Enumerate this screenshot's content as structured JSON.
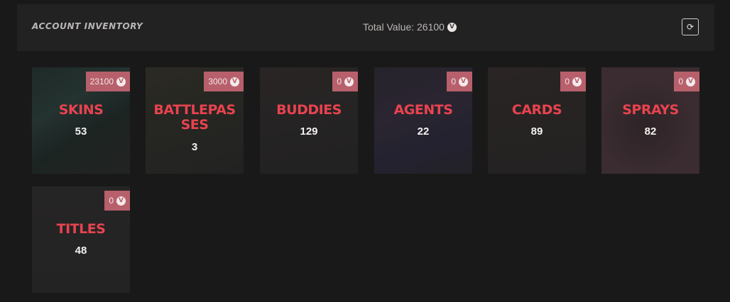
{
  "header": {
    "title": "ACCOUNT INVENTORY",
    "total_label": "Total Value: 26100",
    "refresh_icon": "refresh-icon"
  },
  "currency_icon": "valorant-points-icon",
  "colors": {
    "background": "#1a1919",
    "panel": "#232222",
    "accent": "#e8434f",
    "badge": "#b7606b"
  },
  "cards": [
    {
      "label": "SKINS",
      "count": "53",
      "value": "23100"
    },
    {
      "label": "BATTLEPASSES",
      "count": "3",
      "value": "3000"
    },
    {
      "label": "BUDDIES",
      "count": "129",
      "value": "0"
    },
    {
      "label": "AGENTS",
      "count": "22",
      "value": "0"
    },
    {
      "label": "CARDS",
      "count": "89",
      "value": "0"
    },
    {
      "label": "SPRAYS",
      "count": "82",
      "value": "0"
    },
    {
      "label": "TITLES",
      "count": "48",
      "value": "0"
    }
  ]
}
